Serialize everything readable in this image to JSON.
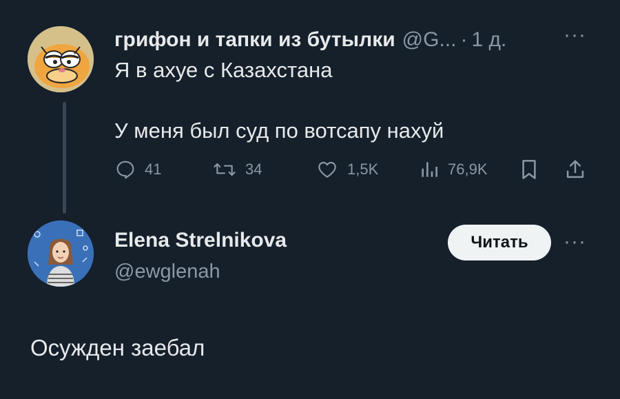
{
  "tweet1": {
    "author_name": "грифон и тапки из бутылки",
    "handle": "@G...",
    "separator": "·",
    "time": "1 д.",
    "more": "···",
    "lines": [
      "Я в ахуе с Казахстана",
      "У меня был суд по вотсапу нахуй"
    ],
    "actions": {
      "replies": "41",
      "reposts": "34",
      "likes": "1,5K",
      "views": "76,9K"
    }
  },
  "tweet2": {
    "author_name": "Elena Strelnikova",
    "handle": "@ewglenah",
    "follow_label": "Читать",
    "more": "···",
    "text": "Осужден заебал"
  },
  "colors": {
    "background": "#15202b",
    "text": "#e7e9ea",
    "muted": "#8b98a5",
    "button_bg": "#eff3f4"
  }
}
